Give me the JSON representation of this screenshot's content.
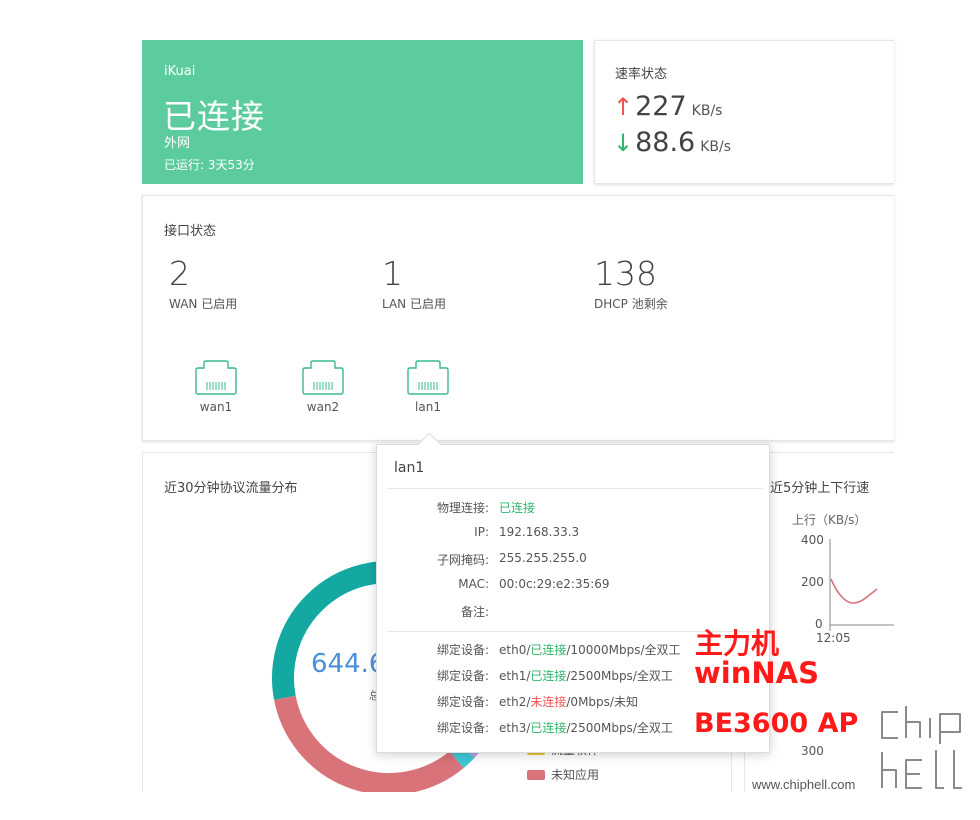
{
  "status": {
    "brand": "iKuai",
    "state": "已连接",
    "type": "外网",
    "uptime": "已运行: 3天53分",
    "bg_color": "#5ccb9d"
  },
  "rate": {
    "title": "速率状态",
    "up_icon": "arrow-up-icon",
    "up_value": "227",
    "up_unit": "KB/s",
    "down_icon": "arrow-down-icon",
    "down_value": "88.6",
    "down_unit": "KB/s"
  },
  "interfaces": {
    "title": "接口状态",
    "stats": [
      {
        "value": "2",
        "label": "WAN 已启用"
      },
      {
        "value": "1",
        "label": "LAN 已启用"
      },
      {
        "value": "138",
        "label": "DHCP 池剩余"
      }
    ],
    "ports": [
      {
        "name": "wan1",
        "icon": "ethernet-port-icon"
      },
      {
        "name": "wan2",
        "icon": "ethernet-port-icon"
      },
      {
        "name": "lan1",
        "icon": "ethernet-port-icon"
      }
    ]
  },
  "traffic": {
    "title": "近30分钟协议流量分布",
    "total_value": "644.6",
    "total_label": "总",
    "legend": [
      {
        "label": "流量软件",
        "color": "#e8c32e"
      },
      {
        "label": "未知应用",
        "color": "#d9737a"
      }
    ],
    "slices": [
      {
        "color": "#14a8a2",
        "fraction": 0.63
      },
      {
        "color": "#b9a0de",
        "fraction": 0.02
      },
      {
        "color": "#3fc7d6",
        "fraction": 0.02
      },
      {
        "color": "#d9737a",
        "fraction": 0.33
      }
    ]
  },
  "chart": {
    "title": "近5分钟上下行速",
    "ylabel": "上行（KB/s）",
    "yticks": [
      "400",
      "200",
      "0"
    ],
    "xtick": "12:05",
    "lower_ytick": "300",
    "line_color": "#d9737a"
  },
  "tooltip": {
    "title": "lan1",
    "rows": [
      {
        "label": "物理连接:",
        "value": "已连接",
        "status": "ok"
      },
      {
        "label": "IP:",
        "value": "192.168.33.3"
      },
      {
        "label": "子网掩码:",
        "value": "255.255.255.0"
      },
      {
        "label": "MAC:",
        "value": "00:0c:29:e2:35:69"
      },
      {
        "label": "备注:",
        "value": ""
      }
    ],
    "bindings": [
      {
        "label": "绑定设备:",
        "iface": "eth0/",
        "status": "已连接",
        "rest": "/10000Mbps/全双工"
      },
      {
        "label": "绑定设备:",
        "iface": "eth1/",
        "status": "已连接",
        "rest": "/2500Mbps/全双工"
      },
      {
        "label": "绑定设备:",
        "iface": "eth2/",
        "status": "未连接",
        "rest": "/0Mbps/未知"
      },
      {
        "label": "绑定设备:",
        "iface": "eth3/",
        "status": "已连接",
        "rest": "/2500Mbps/全双工"
      }
    ],
    "status_colors": {
      "ok": "#2fb56a",
      "bad": "#ef5350"
    }
  },
  "annotations": {
    "main_pc": "主力机",
    "nas": "winNAS",
    "ap": "BE3600 AP",
    "color": "#ff1a1a"
  },
  "watermark": {
    "url": "www.chiphell.com",
    "logo": "chiphell"
  }
}
